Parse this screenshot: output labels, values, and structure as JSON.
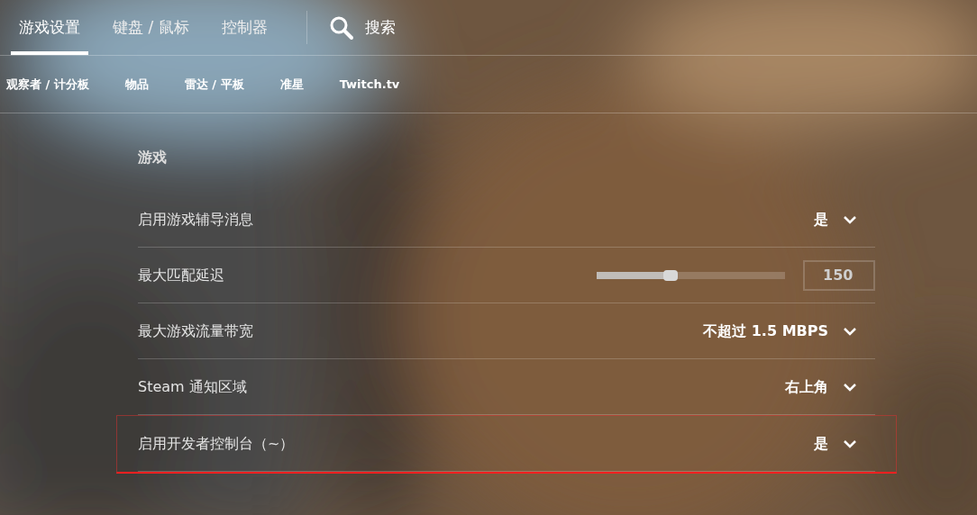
{
  "tabs": [
    {
      "label": "游戏设置",
      "selected": true
    },
    {
      "label": "键盘 / 鼠标",
      "selected": false
    },
    {
      "label": "控制器",
      "selected": false
    }
  ],
  "search": {
    "label": "搜索"
  },
  "subtabs": [
    {
      "label": "观察者 / 计分板"
    },
    {
      "label": "物品"
    },
    {
      "label": "雷达 / 平板"
    },
    {
      "label": "准星"
    },
    {
      "label": "Twitch.tv"
    }
  ],
  "section": {
    "title": "游戏"
  },
  "settings": [
    {
      "kind": "dropdown",
      "label": "启用游戏辅导消息",
      "value": "是",
      "highlighted": false
    },
    {
      "kind": "slider",
      "label": "最大匹配延迟",
      "level": 0.39,
      "value": "150",
      "highlighted": false
    },
    {
      "kind": "dropdown",
      "label": "最大游戏流量带宽",
      "value": "不超过 1.5 MBPS",
      "highlighted": false
    },
    {
      "kind": "dropdown",
      "label": "Steam 通知区域",
      "value": "右上角",
      "highlighted": false
    },
    {
      "kind": "dropdown",
      "label": "启用开发者控制台（~）",
      "value": "是",
      "highlighted": true
    }
  ]
}
